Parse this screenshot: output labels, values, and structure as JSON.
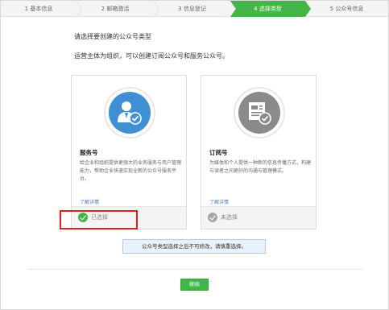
{
  "steps": [
    {
      "label": "1 基本信息"
    },
    {
      "label": "2 邮箱激活"
    },
    {
      "label": "3 信息登记"
    },
    {
      "label": "4 选择类型"
    },
    {
      "label": "5 公众号信息"
    }
  ],
  "active_step": 3,
  "heading": "请选择要创建的公众号类型",
  "description": "运营主体为组织，可以创建订阅公众号和服务公众号。",
  "cards": [
    {
      "name": "服务号",
      "text": "给企业和组织提供更强大的业务服务与用户管理能力，帮助企业快速实现全新的公众号服务平台。",
      "more": "了解详情",
      "status": "已选择",
      "selected": true,
      "icon": "service-account-icon",
      "icon_color": "#3f8fd4"
    },
    {
      "name": "订阅号",
      "text": "为媒体和个人提供一种新的信息传播方式，构建与读者之间更好的沟通与管理模式。",
      "more": "了解详情",
      "status": "未选择",
      "selected": false,
      "icon": "subscription-account-icon",
      "icon_color": "#8a8a8a"
    }
  ],
  "notice": "公众号类型选择之后不可修改，请慎重选择。",
  "next_button": "继续",
  "colors": {
    "accent": "#44b549",
    "highlight": "#e02020",
    "link": "#4a7ab5"
  }
}
